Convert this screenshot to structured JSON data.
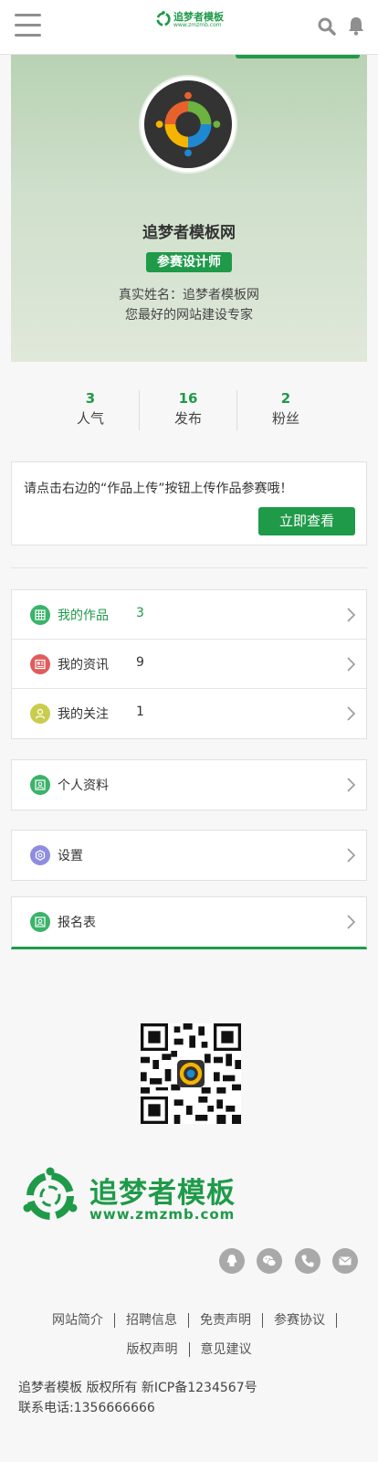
{
  "header": {
    "brand_name": "追梦者模板",
    "brand_url": "www.zmzmb.com"
  },
  "profile": {
    "name": "追梦者模板网",
    "badge": "参赛设计师",
    "real_name": "真实姓名：追梦者模板网",
    "tagline": "您最好的网站建设专家"
  },
  "stats": [
    {
      "value": "3",
      "label": "人气"
    },
    {
      "value": "16",
      "label": "发布"
    },
    {
      "value": "2",
      "label": "粉丝"
    }
  ],
  "notice": {
    "text": "请点击右边的“作品上传”按钮上传作品参赛哦！",
    "button": "立即查看"
  },
  "menu_group1": [
    {
      "label": "我的作品",
      "count": "3",
      "icon": "grid-icon",
      "color": "#3bb36a"
    },
    {
      "label": "我的资讯",
      "count": "9",
      "icon": "news-icon",
      "color": "#e05c5c"
    },
    {
      "label": "我的关注",
      "count": "1",
      "icon": "user-icon",
      "color": "#c9cd4b"
    }
  ],
  "menu_group2": [
    {
      "label": "个人资料",
      "icon": "profile-icon",
      "color": "#3bb36a"
    }
  ],
  "menu_group3": [
    {
      "label": "设置",
      "icon": "settings-icon",
      "color": "#8e8ee0"
    }
  ],
  "menu_group4": [
    {
      "label": "报名表",
      "icon": "form-icon",
      "color": "#3bb36a"
    }
  ],
  "footer": {
    "logo_name": "追梦者模板",
    "logo_url": "www.zmzmb.com",
    "social_icons": [
      "qq-icon",
      "wechat-icon",
      "phone-icon",
      "mail-icon"
    ],
    "links": [
      "网站简介",
      "招聘信息",
      "免责声明",
      "参赛协议",
      "版权声明",
      "意见建议"
    ],
    "copyright": "追梦者模板 版权所有 新ICP备1234567号",
    "phone": "联系电话:1356666666"
  },
  "colors": {
    "accent": "#1f9a49"
  }
}
